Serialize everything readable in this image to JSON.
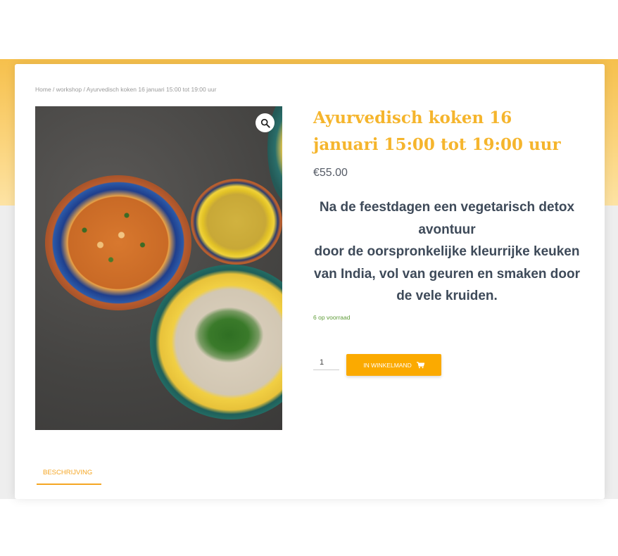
{
  "breadcrumb": {
    "home": "Home",
    "separator": " / ",
    "category": "workshop",
    "current": "Ayurvedisch koken 16 januari 15:00 tot 19:00 uur"
  },
  "product": {
    "title": "Ayurvedisch koken 16 januari 15:00 tot 19:00 uur",
    "price": "€55.00",
    "description": [
      "Na de feestdagen een vegetarisch detox avontuur",
      "door de oorspronkelijke kleurrijke keuken van India, vol van geuren en smaken door de vele kruiden."
    ],
    "stock": "6 op voorraad",
    "quantity": "1",
    "add_to_cart_label": "IN WINKELMAND",
    "image_alt": "food-photo"
  },
  "tabs": [
    {
      "label": "BESCHRIJVING",
      "active": true
    }
  ],
  "icons": {
    "zoom": "magnifier-icon",
    "cart": "cart-icon"
  },
  "colors": {
    "accent": "#f5b52d",
    "button": "#fbaa00",
    "stock": "#5e9b37",
    "text": "#3e4a59"
  }
}
